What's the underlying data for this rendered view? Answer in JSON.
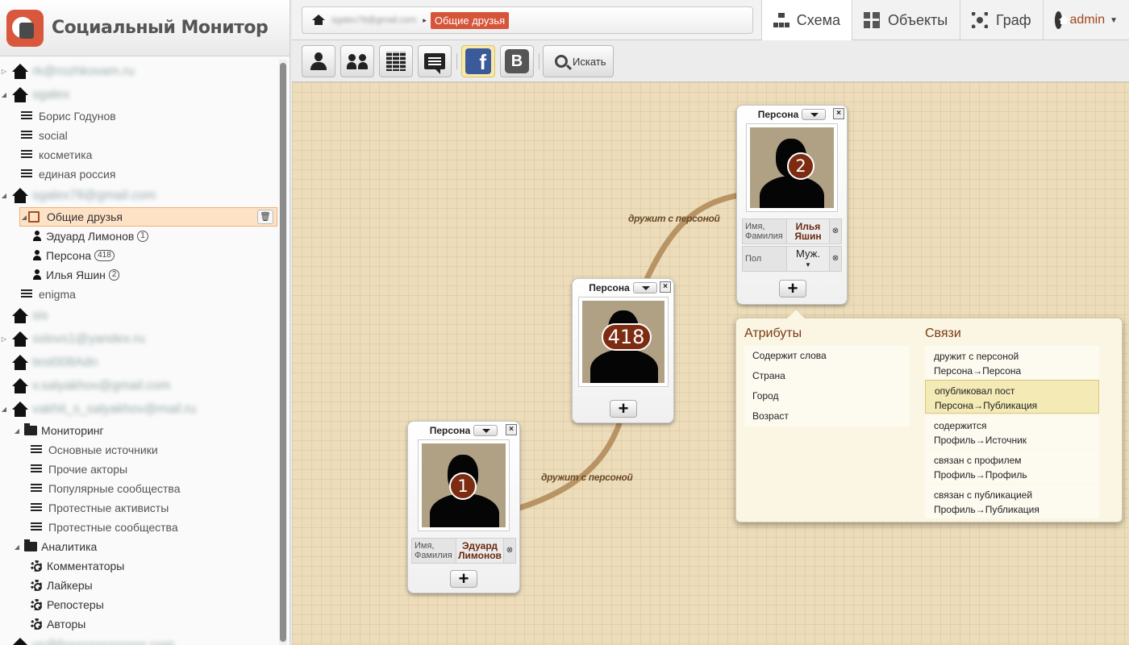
{
  "app": {
    "title": "Социальный Монитор"
  },
  "breadcrumb": {
    "account": "sgalex78@gmail.com",
    "current": "Общие друзья"
  },
  "tabs": [
    {
      "label": "Схема",
      "icon": "schema-icon",
      "active": true
    },
    {
      "label": "Объекты",
      "icon": "objects-icon"
    },
    {
      "label": "Граф",
      "icon": "graph-icon"
    },
    {
      "label": "admin",
      "icon": "home-circle-icon"
    }
  ],
  "toolbar": {
    "search_label": "Искать",
    "facebook_label": "f",
    "vk_label": "B"
  },
  "sidebar": {
    "accounts": {
      "a1": "rk@rozhkovam.ru",
      "a2": "sgalex",
      "a3": "sgalex78@gmail.com",
      "a4": "sis",
      "a5": "sslovs1@yandex.ru",
      "a6": "test008Adn",
      "a7": "v.salyakhov@gmail.com",
      "a8": "vakhit_s_salyakhov@mail.ru",
      "a9": "vs@foxxxxxxxxxxxx.com"
    },
    "sgalex_items": [
      "Борис Годунов",
      "social",
      "косметика",
      "единая россия"
    ],
    "selected": "Общие друзья",
    "persons": [
      {
        "label": "Эдуард Лимонов",
        "badge": "1"
      },
      {
        "label": "Персона",
        "badge": "418"
      },
      {
        "label": "Илья Яшин",
        "badge": "2"
      }
    ],
    "enigma": "enigma",
    "monitoring": {
      "label": "Мониторинг",
      "items": [
        "Основные источники",
        "Прочие акторы",
        "Популярные сообщества",
        "Протестные активисты",
        "Протестные сообщества"
      ]
    },
    "analytics": {
      "label": "Аналитика",
      "items": [
        "Комментаторы",
        "Лайкеры",
        "Репостеры",
        "Авторы"
      ]
    }
  },
  "canvas": {
    "edge_label": "дружит с персоной",
    "nodes": [
      {
        "type": "Персона",
        "number": "2",
        "attrs": [
          {
            "key": "Имя, Фамилия",
            "value": "Илья Яшин"
          },
          {
            "key": "Пол",
            "value": "Муж."
          }
        ]
      },
      {
        "type": "Персона",
        "number": "418",
        "attrs": []
      },
      {
        "type": "Персона",
        "number": "1",
        "attrs": [
          {
            "key": "Имя, Фамилия",
            "value": "Эдуард Лимонов"
          }
        ]
      }
    ],
    "add_symbol": "+",
    "close_symbol": "×",
    "remove_symbol": "⊗"
  },
  "popover": {
    "attributes_title": "Атрибуты",
    "attributes": [
      "Содержит слова",
      "Страна",
      "Город",
      "Возраст"
    ],
    "links_title": "Связи",
    "links": [
      {
        "name": "дружит с персоной",
        "path": "Персона→Персона"
      },
      {
        "name": "опубликовал пост",
        "path": "Персона→Публикация",
        "highlighted": true
      },
      {
        "name": "содержится",
        "path": "Профиль→Источник"
      },
      {
        "name": "связан с профилем",
        "path": "Профиль→Профиль"
      },
      {
        "name": "связан с публикацией",
        "path": "Профиль→Публикация"
      }
    ]
  },
  "colors": {
    "accent": "#d6553a",
    "canvas": "#ecdcba",
    "edge": "#b89464",
    "badge": "#7d2c12"
  }
}
